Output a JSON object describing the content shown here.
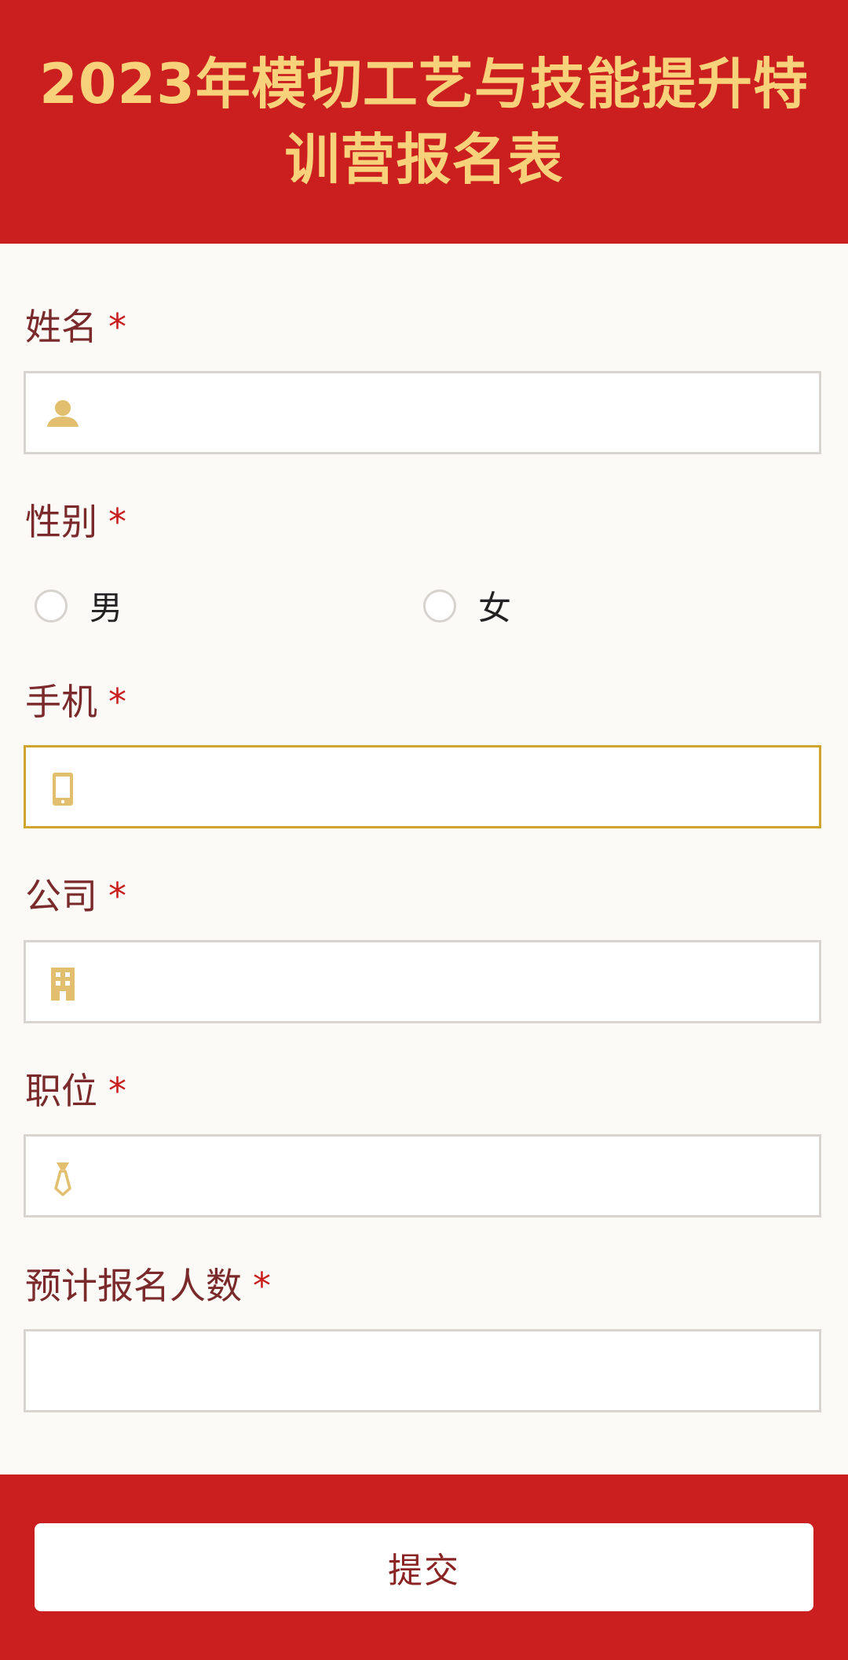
{
  "header": {
    "title": "2023年模切工艺与技能提升特训营报名表"
  },
  "colors": {
    "brand_red": "#cb1e1e",
    "title_gold": "#f7d27a",
    "icon_gold": "#e1bf6e",
    "focus_border": "#cfa42f"
  },
  "form": {
    "required_mark": "*",
    "name": {
      "label": "姓名",
      "icon": "user-icon",
      "value": ""
    },
    "gender": {
      "label": "性别",
      "options": [
        {
          "label": "男",
          "selected": false
        },
        {
          "label": "女",
          "selected": false
        }
      ]
    },
    "phone": {
      "label": "手机",
      "icon": "mobile-phone-icon",
      "value": "",
      "focused": true
    },
    "company": {
      "label": "公司",
      "icon": "building-icon",
      "value": ""
    },
    "position": {
      "label": "职位",
      "icon": "tie-icon",
      "value": ""
    },
    "count": {
      "label": "预计报名人数",
      "value": ""
    }
  },
  "footer": {
    "submit_label": "提交"
  }
}
